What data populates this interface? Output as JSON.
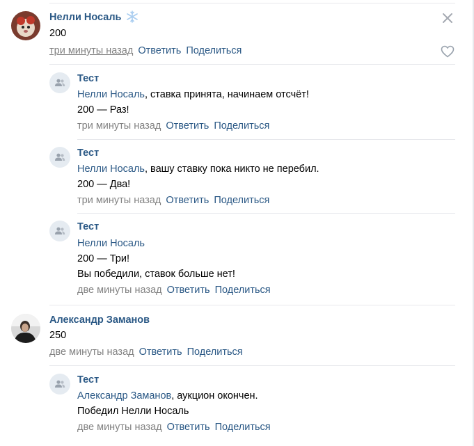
{
  "comments": [
    {
      "author": "Нелли Носаль",
      "text": "200",
      "time": "три минуты назад",
      "reply": "Ответить",
      "share": "Поделиться"
    },
    {
      "author": "Александр Заманов",
      "text": "250",
      "time": "две минуты назад",
      "reply": "Ответить",
      "share": "Поделиться"
    }
  ],
  "replies": [
    {
      "author": "Тест",
      "mention": "Нелли Носаль",
      "line1_rest": ", ставка принята, начинаем отсчёт!",
      "line2": "200 — Раз!",
      "time": "три минуты назад",
      "reply": "Ответить",
      "share": "Поделиться"
    },
    {
      "author": "Тест",
      "mention": "Нелли Носаль",
      "line1_rest": ", вашу ставку пока никто не перебил.",
      "line2": "200 — Два!",
      "time": "три минуты назад",
      "reply": "Ответить",
      "share": "Поделиться"
    },
    {
      "author": "Тест",
      "mention": "Нелли Носаль",
      "line2": "200 — Три!",
      "line3": "Вы победили, ставок больше нет!",
      "time": "две минуты назад",
      "reply": "Ответить",
      "share": "Поделиться"
    },
    {
      "author": "Тест",
      "mention": "Александр Заманов",
      "line1_rest": ", аукцион окончен.",
      "line2": "Победил Нелли Носаль",
      "time": "две минуты назад",
      "reply": "Ответить",
      "share": "Поделиться"
    }
  ],
  "icons": {
    "close": "close-icon",
    "like": "heart-icon",
    "badge": "snowflake-icon",
    "group_avatar": "group-users-icon"
  },
  "colors": {
    "link": "#2a5885",
    "meta": "#828282",
    "divider": "#e7e8ec",
    "avatar_bg": "#e5ebf1",
    "icon_gray": "#99a2ad"
  }
}
